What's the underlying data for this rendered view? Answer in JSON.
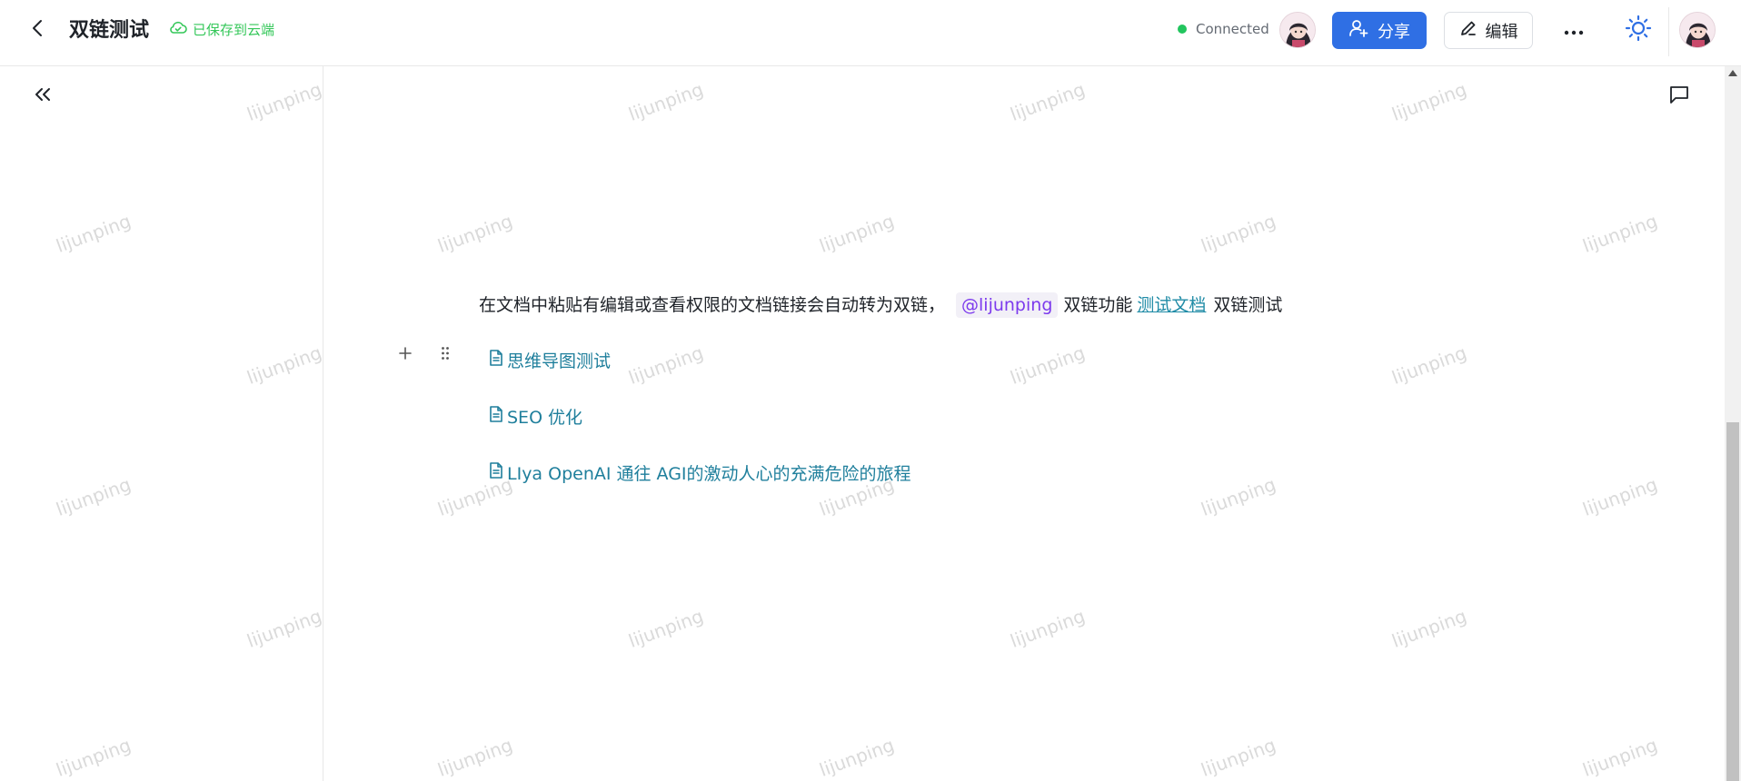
{
  "header": {
    "title": "双链测试",
    "save_status": "已保存到云端",
    "connection_status": "Connected",
    "share_label": "分享",
    "edit_label": "编辑"
  },
  "document": {
    "paragraph": {
      "text_before": "在文档中粘贴有编辑或查看权限的文档链接会自动转为双链，",
      "mention": "@lijunping",
      "text_middle": "双链功能",
      "link": "测试文档",
      "text_after": "双链测试"
    },
    "doc_links": [
      {
        "label": "思维导图测试"
      },
      {
        "label": "SEO 优化"
      },
      {
        "label": "LIya OpenAI 通往 AGI的激动人心的充满危险的旅程"
      }
    ]
  },
  "watermark": "lijunping",
  "colors": {
    "primary": "#2f6fe4",
    "success": "#34c759",
    "connected_dot": "#22c55e",
    "link": "#1f7f9c",
    "mention": "#7c3aed"
  },
  "icons": {
    "back": "chevron-left-icon",
    "cloud": "cloud-check-icon",
    "share": "user-plus-icon",
    "edit": "pencil-icon",
    "more": "more-horizontal-icon",
    "theme": "sun-icon",
    "collapse": "chevrons-left-icon",
    "comment": "message-square-icon",
    "doc": "file-text-icon",
    "plus": "plus-icon",
    "drag": "drag-handle-icon"
  }
}
